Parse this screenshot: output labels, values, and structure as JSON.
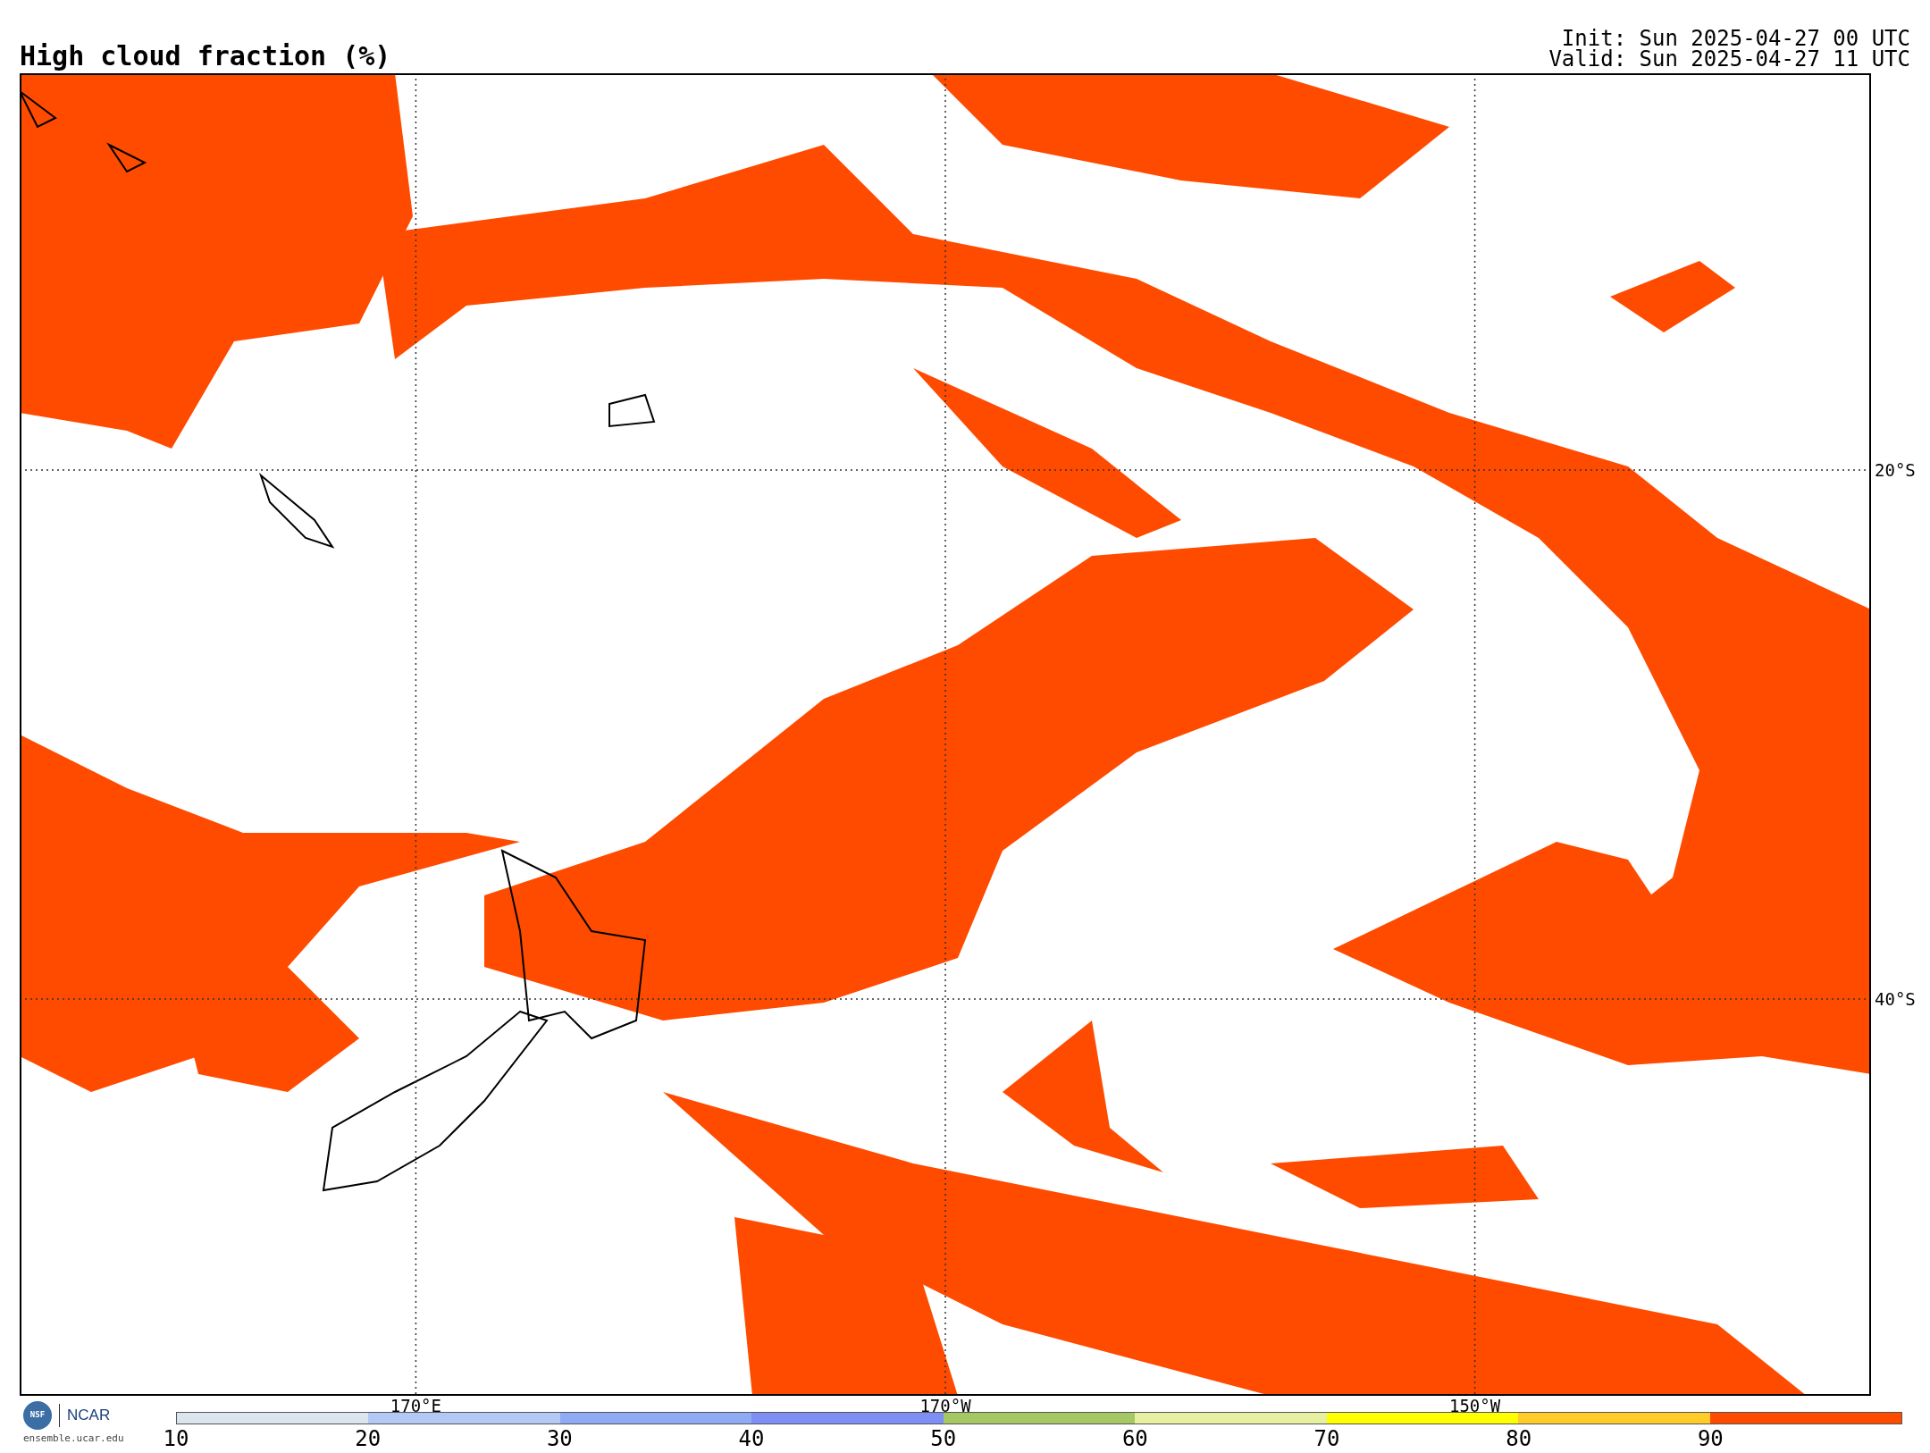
{
  "title": "High cloud fraction (%)",
  "init": "Init: Sun 2025-04-27 00 UTC",
  "valid": "Valid: Sun 2025-04-27 11 UTC",
  "lat_labels": [
    "20°S",
    "40°S"
  ],
  "lon_labels": [
    "170°E",
    "170°W",
    "150°W"
  ],
  "logo": {
    "badge": "NSF",
    "name": "NCAR",
    "site": "ensemble.ucar.edu"
  },
  "colorbar": {
    "segments": [
      {
        "color": "#dce4ee"
      },
      {
        "color": "#b4c8f5"
      },
      {
        "color": "#90aaf5"
      },
      {
        "color": "#7d8ef5"
      },
      {
        "color": "#a5c864"
      },
      {
        "color": "#e6f0a0"
      },
      {
        "color": "#ffff00"
      },
      {
        "color": "#ffcc28"
      },
      {
        "color": "#ff4b00"
      }
    ],
    "ticks": [
      "10",
      "20",
      "30",
      "40",
      "50",
      "60",
      "70",
      "80",
      "90"
    ]
  }
}
